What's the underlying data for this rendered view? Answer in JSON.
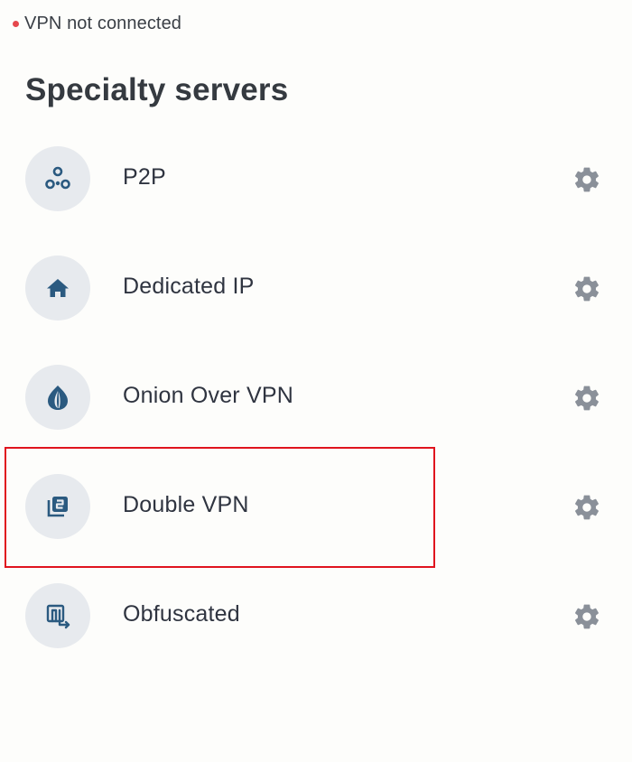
{
  "status": {
    "text": "VPN not connected",
    "dot_color": "#e5484d"
  },
  "title": "Specialty servers",
  "servers": [
    {
      "label": "P2P",
      "icon": "p2p-icon"
    },
    {
      "label": "Dedicated IP",
      "icon": "house-icon"
    },
    {
      "label": "Onion Over VPN",
      "icon": "onion-icon"
    },
    {
      "label": "Double VPN",
      "icon": "double-vpn-icon",
      "highlighted": true
    },
    {
      "label": "Obfuscated",
      "icon": "obfuscated-icon"
    }
  ],
  "colors": {
    "icon_fg": "#2b5a80",
    "gear": "#8a9099",
    "icon_bg": "#e7eaee",
    "highlight": "#e0141e"
  }
}
